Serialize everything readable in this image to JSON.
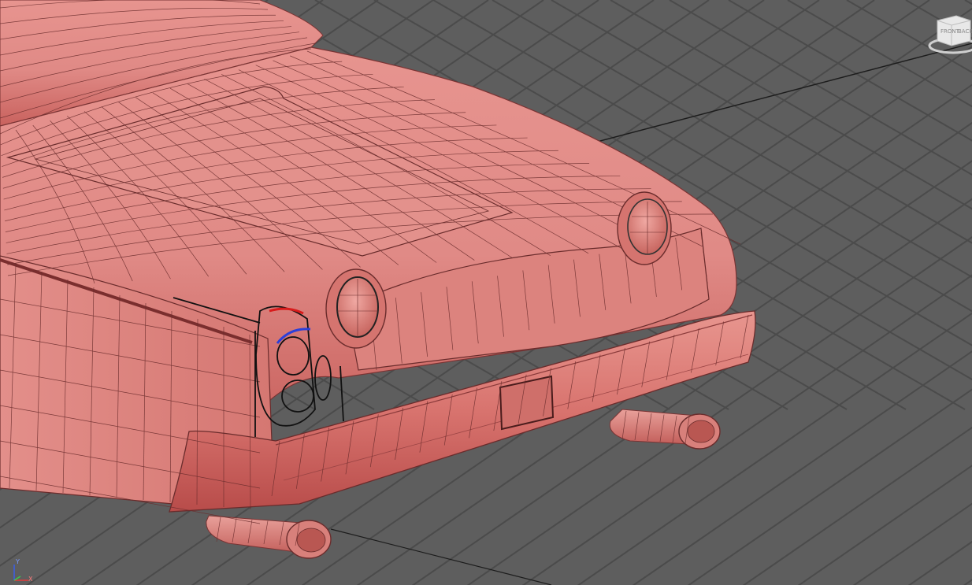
{
  "viewport": {
    "label": "",
    "background_color": "#5e5e5e",
    "grid_color": "#4b4b4b",
    "axis_line_color": "#222222"
  },
  "model": {
    "surface_color": "#e08a86",
    "surface_shadow": "#b8524f",
    "wire_color": "#6a2c2c",
    "curve_color": "#111111",
    "manip_red": "#d81b1b",
    "manip_blue": "#2c3fd8"
  },
  "viewcube": {
    "icon": "view-cube-icon",
    "face_front": "FRONT",
    "face_back": "BACK"
  },
  "axis_tripod": {
    "icon": "axis-tripod-icon",
    "y_label": "Y",
    "x_label": "X"
  }
}
